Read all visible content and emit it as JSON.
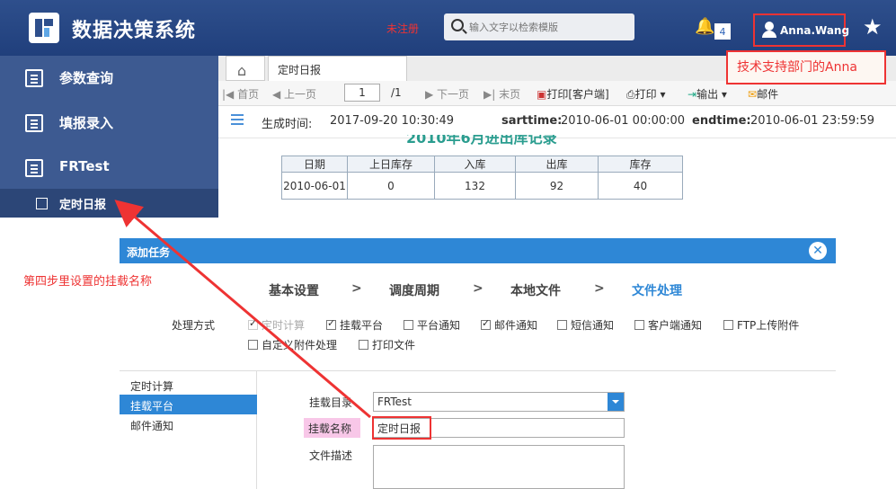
{
  "header": {
    "app_title": "数据决策系统",
    "unregistered": "未注册",
    "search_placeholder": "输入文字以检索模版",
    "notification_count": "4",
    "user_name": "Anna.Wang",
    "icons": [
      "logo-icon",
      "search-icon",
      "bell-icon",
      "user-icon",
      "star-icon"
    ]
  },
  "annotations": {
    "user_note": "技术支持部门的Anna",
    "step_note": "第四步里设置的挂载名称",
    "accent_color": "#e33333"
  },
  "sidebar": {
    "items": [
      {
        "label": "参数查询"
      },
      {
        "label": "填报录入"
      },
      {
        "label": "FRTest"
      }
    ],
    "sub_item": "定时日报"
  },
  "tabs": {
    "active": "定时日报"
  },
  "toolbar": {
    "first": "首页",
    "prev": "上一页",
    "page_value": "1",
    "total": "/1",
    "next": "下一页",
    "last": "末页",
    "print_client": "打印[客户端]",
    "print": "打印",
    "export": "输出",
    "mail": "邮件"
  },
  "infoline": {
    "gen_label": "生成时间:",
    "gen_value": "2017-09-20 10:30:49",
    "start_label": "sarttime:",
    "start_value": "2010-06-01 00:00:00",
    "end_label": "endtime:",
    "end_value": "2010-06-01 23:59:59"
  },
  "report": {
    "title": "2010年6月进出库记录",
    "columns": [
      "日期",
      "上日库存",
      "入库",
      "出库",
      "库存"
    ],
    "rows": [
      [
        "2010-06-01",
        "0",
        "132",
        "92",
        "40"
      ]
    ]
  },
  "dialog": {
    "title": "添加任务",
    "steps": [
      "基本设置",
      "调度周期",
      "本地文件",
      "文件处理"
    ],
    "step_sep": ">",
    "process_label": "处理方式",
    "options": [
      {
        "label": "定时计算",
        "checked": true,
        "disabled": true
      },
      {
        "label": "挂载平台",
        "checked": true
      },
      {
        "label": "平台通知",
        "checked": false
      },
      {
        "label": "邮件通知",
        "checked": true
      },
      {
        "label": "短信通知",
        "checked": false
      },
      {
        "label": "客户端通知",
        "checked": false
      },
      {
        "label": "FTP上传附件",
        "checked": false
      },
      {
        "label": "自定义附件处理",
        "checked": false
      },
      {
        "label": "打印文件",
        "checked": false
      }
    ],
    "left_list": [
      "定时计算",
      "挂载平台",
      "邮件通知"
    ],
    "mount_dir_label": "挂载目录",
    "mount_dir_value": "FRTest",
    "mount_name_label": "挂载名称",
    "mount_name_value": "定时日报",
    "file_desc_label": "文件描述"
  }
}
